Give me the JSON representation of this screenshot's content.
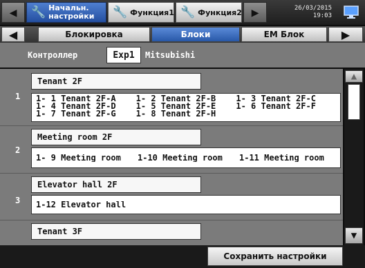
{
  "header": {
    "tabs": [
      {
        "label_line1": "Начальн.",
        "label_line2": "настройки",
        "icon": "wrench-icon",
        "active": true
      },
      {
        "label": "Функция1",
        "icon": "wrench-icon",
        "active": false
      },
      {
        "label": "Функция2",
        "icon": "wrench-icon",
        "active": false
      }
    ],
    "date": "26/03/2015",
    "time": "19:03",
    "left_arrow": "◀",
    "right_arrow": "▶",
    "monitor_icon": "monitor-icon"
  },
  "subtabs": {
    "left_arrow": "◀",
    "right_arrow": "▶",
    "items": [
      {
        "label": "Блокировка",
        "active": false
      },
      {
        "label": "Блоки",
        "active": true
      },
      {
        "label": "EM Блок",
        "active": false
      }
    ]
  },
  "controller": {
    "label": "Контроллер",
    "button": "Exp1",
    "value": "Mitsubishi"
  },
  "groups": [
    {
      "number": "1",
      "name": "Tenant 2F",
      "units": [
        [
          "1- 1 Tenant 2F-A",
          "1- 2 Tenant 2F-B",
          "1- 3 Tenant 2F-C"
        ],
        [
          "1- 4 Tenant 2F-D",
          "1- 5 Tenant 2F-E",
          "1- 6 Tenant 2F-F"
        ],
        [
          "1- 7 Tenant 2F-G",
          "1- 8 Tenant 2F-H",
          ""
        ]
      ]
    },
    {
      "number": "2",
      "name": "Meeting room 2F",
      "units": [
        [
          "1- 9 Meeting room",
          "1-10 Meeting room",
          "1-11 Meeting room"
        ]
      ]
    },
    {
      "number": "3",
      "name": "Elevator hall 2F",
      "units": [
        [
          "1-12 Elevator hall",
          "",
          ""
        ]
      ]
    },
    {
      "number": "",
      "name": "Tenant 3F",
      "units": []
    }
  ],
  "scrollbar": {
    "up": "▲",
    "down": "▼"
  },
  "footer": {
    "save_label": "Сохранить настройки"
  }
}
